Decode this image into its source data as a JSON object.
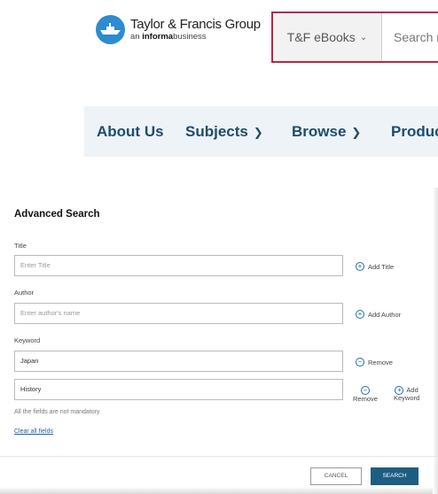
{
  "header": {
    "logo_name": "Taylor & Francis Group",
    "logo_sub_prefix": "an",
    "logo_sub_bold": "informa",
    "logo_sub_suffix": "business",
    "brand_color": "#2d8bd2",
    "search_scope": "T&F eBooks",
    "search_placeholder": "Search r",
    "search_border_color": "#b8274a"
  },
  "nav": {
    "items": [
      {
        "label": "About Us"
      },
      {
        "label": "Subjects",
        "icon": "chevron-down-icon"
      },
      {
        "label": "Browse",
        "icon": "chevron-down-icon"
      },
      {
        "label": "Produc"
      }
    ]
  },
  "advanced_search": {
    "title": "Advanced Search",
    "title_label": "Title",
    "title_placeholder": "Enter Title",
    "add_title": "Add Title",
    "author_label": "Author",
    "author_placeholder": "Enter author's name",
    "add_author": "Add Author",
    "keyword_label": "Keyword",
    "keyword_1": "Japan",
    "remove_1": "Remove",
    "keyword_2": "History",
    "remove_2": "Remove",
    "add_keyword_line1": "Add",
    "add_keyword_line2": "Keyword",
    "note": "All the fields are not mandatory",
    "clear_all": "Clear all fields",
    "cancel": "CANCEL",
    "search": "SEARCH",
    "accent_color": "#1d5d82"
  }
}
